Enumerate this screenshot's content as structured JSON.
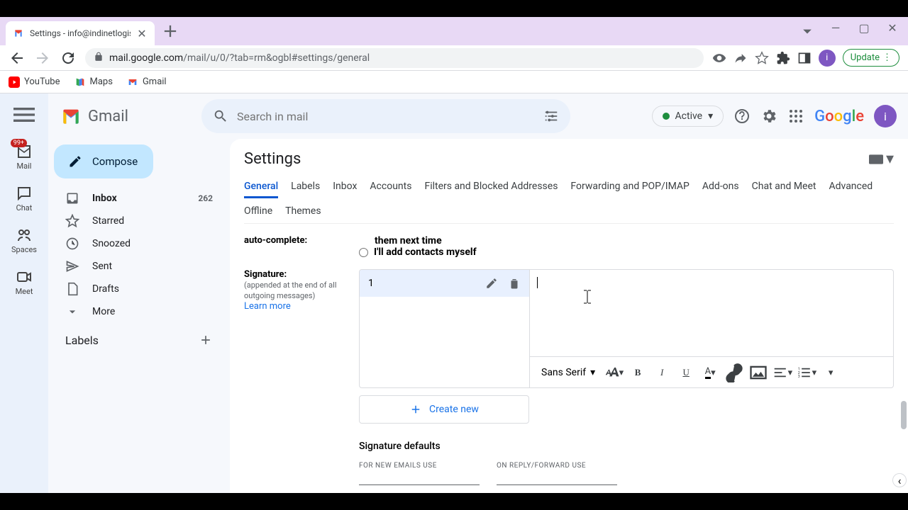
{
  "browser": {
    "tab_title": "Settings - info@indinetlogistics.c",
    "url_prefix": "mail.google.com",
    "url_path": "/mail/u/0/?tab=rm&ogbl#settings/general",
    "update_label": "Update",
    "profile_letter": "i"
  },
  "bookmarks": [
    {
      "label": "YouTube"
    },
    {
      "label": "Maps"
    },
    {
      "label": "Gmail"
    }
  ],
  "rail": {
    "mail": "Mail",
    "mail_badge": "99+",
    "chat": "Chat",
    "spaces": "Spaces",
    "meet": "Meet"
  },
  "header": {
    "app_name": "Gmail",
    "search_placeholder": "Search in mail",
    "status_label": "Active",
    "avatar_letter": "i"
  },
  "sidebar": {
    "compose": "Compose",
    "items": [
      {
        "label": "Inbox",
        "count": "262"
      },
      {
        "label": "Starred"
      },
      {
        "label": "Snoozed"
      },
      {
        "label": "Sent"
      },
      {
        "label": "Drafts"
      },
      {
        "label": "More"
      }
    ],
    "labels_header": "Labels"
  },
  "settings": {
    "title": "Settings",
    "tabs": [
      "General",
      "Labels",
      "Inbox",
      "Accounts",
      "Filters and Blocked Addresses",
      "Forwarding and POP/IMAP",
      "Add-ons",
      "Chat and Meet",
      "Advanced",
      "Offline",
      "Themes"
    ],
    "autocomplete_label": "auto-complete:",
    "autocomplete_line1": "them next time",
    "autocomplete_option": "I'll add contacts myself",
    "signature_label": "Signature:",
    "signature_sub": "(appended at the end of all outgoing messages)",
    "learn_more": "Learn more",
    "signature_name": "1",
    "font_label": "Sans Serif",
    "create_new": "Create new",
    "defaults_title": "Signature defaults",
    "defaults_new": "FOR NEW EMAILS USE",
    "defaults_reply": "ON REPLY/FORWARD USE"
  }
}
